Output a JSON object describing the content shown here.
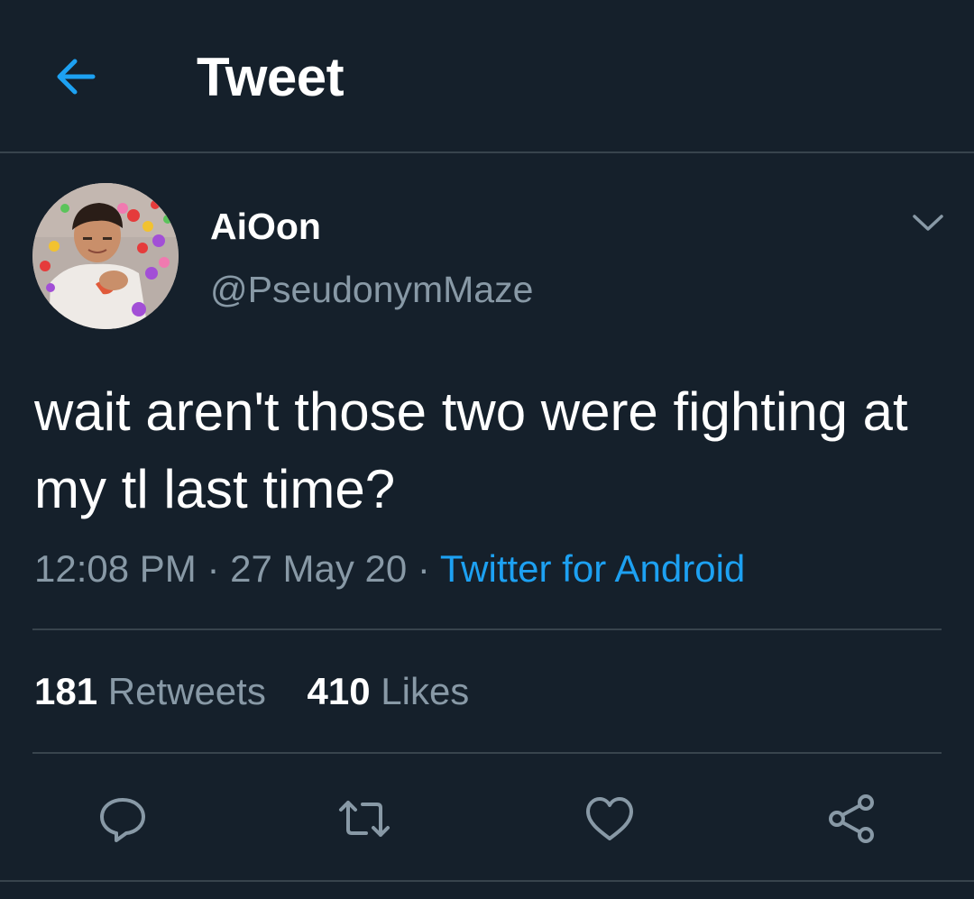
{
  "header": {
    "title": "Tweet",
    "back_icon": "arrow-left-icon"
  },
  "author": {
    "display_name": "AiOon",
    "handle": "@PseudonymMaze",
    "more_icon": "chevron-down-icon"
  },
  "tweet": {
    "text": "wait aren't those two were fighting at my tl last time?",
    "time": "12:08 PM",
    "date": "27 May 20",
    "separator": " · ",
    "source": "Twitter for Android"
  },
  "stats": {
    "retweets_count": "181",
    "retweets_label": "Retweets",
    "likes_count": "410",
    "likes_label": "Likes"
  },
  "actions": {
    "reply": "reply-icon",
    "retweet": "retweet-icon",
    "like": "heart-icon",
    "share": "share-icon"
  },
  "colors": {
    "background": "#15202b",
    "accent": "#1da1f2",
    "muted": "#8899a6",
    "divider": "#38444d",
    "text": "#ffffff"
  }
}
